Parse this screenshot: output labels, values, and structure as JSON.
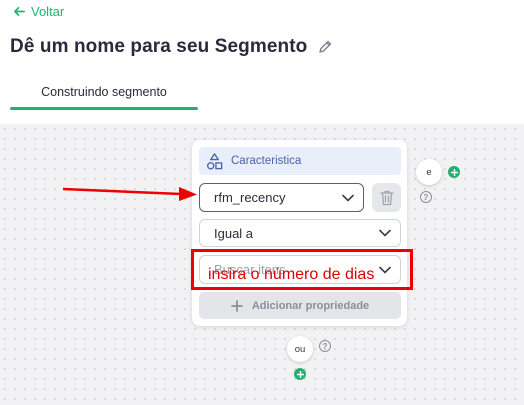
{
  "header": {
    "back_label": "Voltar",
    "title": "Dê um nome para seu Segmento"
  },
  "tabs": [
    {
      "label": "Construindo segmento",
      "active": true
    }
  ],
  "condition_card": {
    "header_label": "Caracteristica",
    "field_value": "rfm_recency",
    "operator_value": "Igual a",
    "search_placeholder": "Buscar itens",
    "add_property_label": "Adicionar propriedade"
  },
  "connectors": {
    "and_label": "e",
    "or_label": "ou",
    "help_glyph": "?"
  },
  "annotation": {
    "text": "insira o número de dias",
    "color": "#e00000"
  },
  "colors": {
    "accent": "#1fb26f",
    "characteristic_header_bg": "#e8effa",
    "characteristic_header_text": "#4863a8"
  },
  "icons": [
    "arrow-left-icon",
    "pencil-icon",
    "shapes-icon",
    "chevron-down-icon",
    "trash-icon",
    "plus-icon",
    "help-icon"
  ]
}
